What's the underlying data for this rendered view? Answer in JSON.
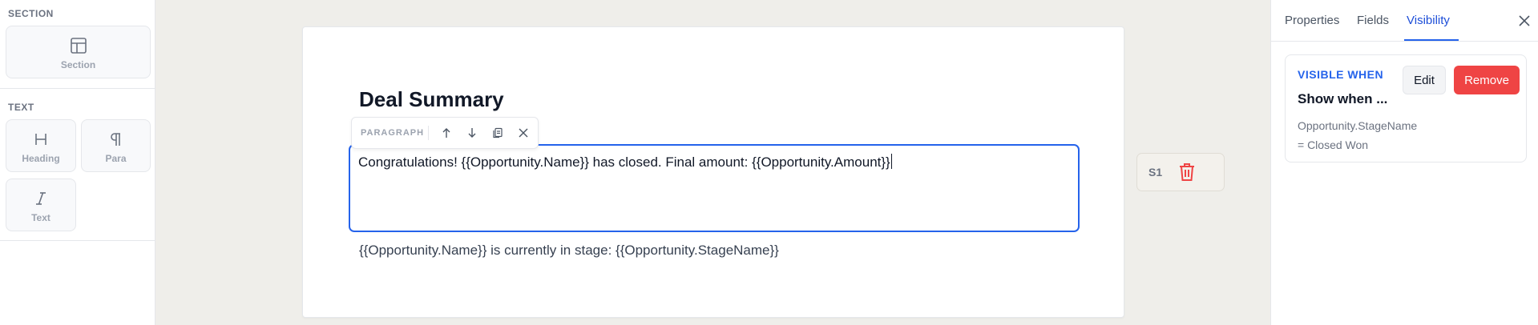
{
  "palette": {
    "section_group": "SECTION",
    "section_tile": {
      "label": "Section",
      "icon": "layout-icon"
    },
    "text_group": "TEXT",
    "heading_tile": {
      "label": "Heading",
      "icon": "heading-icon"
    },
    "para_tile": {
      "label": "Para",
      "icon": "pilcrow-icon"
    },
    "text_tile": {
      "label": "Text",
      "icon": "italic-icon"
    }
  },
  "canvas": {
    "heading": "Deal Summary",
    "toolbar": {
      "label": "PARAGRAPH",
      "icons": [
        "arrow-up-icon",
        "arrow-down-icon",
        "duplicate-icon",
        "close-icon"
      ]
    },
    "selected_paragraph": "Congratulations! {{Opportunity.Name}} has closed. Final amount: {{Opportunity.Amount}}",
    "paragraph_2": "{{Opportunity.Name}} is currently in stage: {{Opportunity.StageName}}"
  },
  "section_chip": {
    "label": "S1",
    "icon": "trash-icon"
  },
  "panel": {
    "tabs": [
      "Properties",
      "Fields",
      "Visibility"
    ],
    "active_tab": "Visibility",
    "rule": {
      "kicker": "VISIBLE WHEN",
      "title": "Show when ...",
      "field": "Opportunity.StageName",
      "condition": "= Closed Won",
      "edit_label": "Edit",
      "remove_label": "Remove"
    }
  },
  "colors": {
    "accent": "#2563eb",
    "danger": "#ef4444",
    "canvas_bg": "#efeeea"
  }
}
